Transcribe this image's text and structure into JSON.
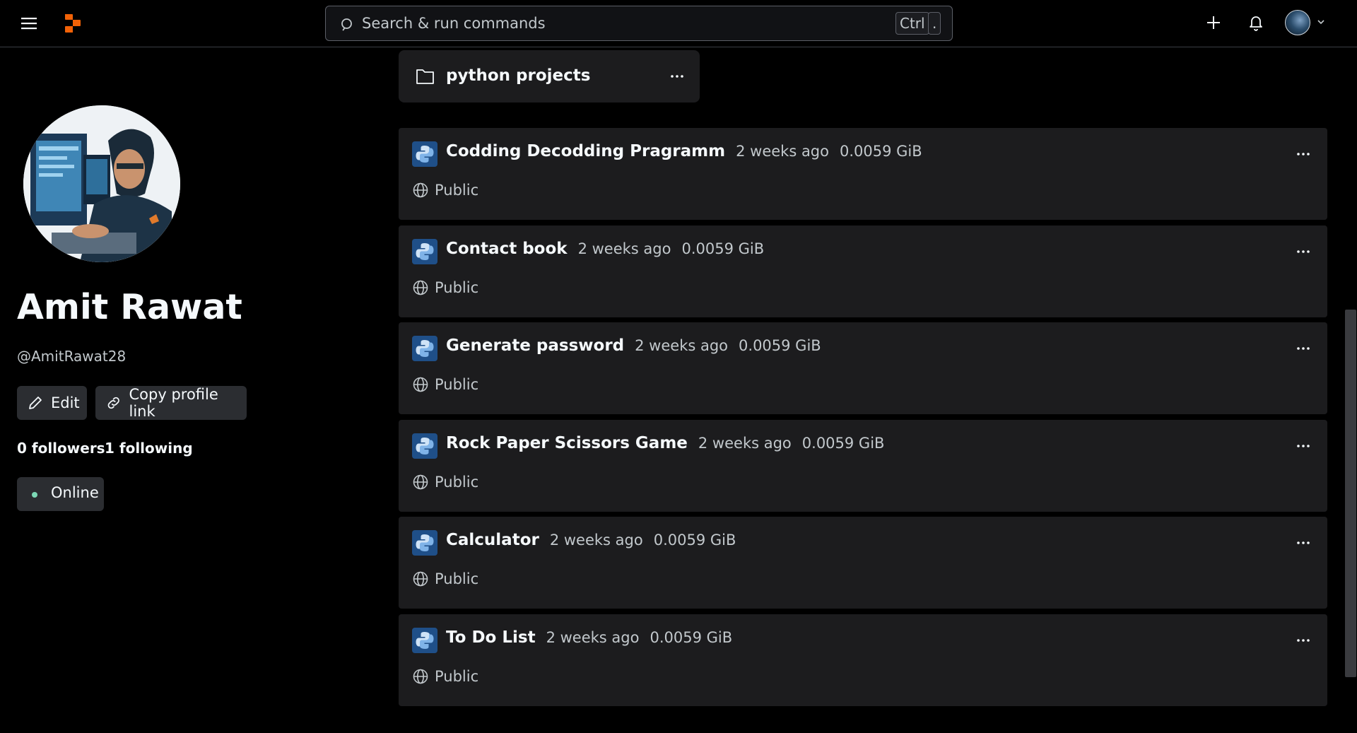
{
  "header": {
    "search_placeholder": "Search & run commands",
    "shortcut_ctrl": "Ctrl",
    "shortcut_key": ".",
    "icons": [
      "menu-icon",
      "replit-logo",
      "search-icon",
      "plus-icon",
      "bell-icon",
      "chevron-down-icon"
    ]
  },
  "profile": {
    "name": "Amit Rawat",
    "handle": "@AmitRawat28",
    "edit_label": "Edit",
    "copy_link_label": "Copy profile link",
    "followers": "0 followers",
    "following": "1 following",
    "status": "Online"
  },
  "folder": {
    "name": "python projects"
  },
  "repls": [
    {
      "title": "Codding Decodding Pragramm",
      "time": "2 weeks ago",
      "size": "0.0059 GiB",
      "visibility": "Public"
    },
    {
      "title": "Contact book",
      "time": "2 weeks ago",
      "size": "0.0059 GiB",
      "visibility": "Public"
    },
    {
      "title": "Generate password",
      "time": "2 weeks ago",
      "size": "0.0059 GiB",
      "visibility": "Public"
    },
    {
      "title": "Rock Paper Scissors Game",
      "time": "2 weeks ago",
      "size": "0.0059 GiB",
      "visibility": "Public"
    },
    {
      "title": "Calculator",
      "time": "2 weeks ago",
      "size": "0.0059 GiB",
      "visibility": "Public"
    },
    {
      "title": "To Do List",
      "time": "2 weeks ago",
      "size": "0.0059 GiB",
      "visibility": "Public"
    }
  ],
  "colors": {
    "background": "#000000",
    "card": "#1c1c1e",
    "brand": "#f26207",
    "online": "#7cd8b5",
    "python_tile": "#1f4f88"
  }
}
